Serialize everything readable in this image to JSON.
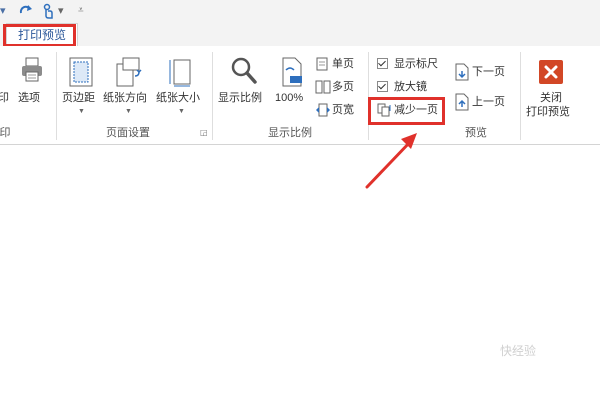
{
  "qat": {
    "undo_caret": "▾",
    "redo_caret": "▾",
    "customize": "⩡"
  },
  "tabs": {
    "print_preview": "打印预览"
  },
  "ribbon": {
    "print_group": {
      "options_label": "选项",
      "partial_left": "印",
      "group_label_partial": "印"
    },
    "page_setup": {
      "margins": "页边距",
      "orientation": "纸张方向",
      "size": "纸张大小",
      "group_label": "页面设置"
    },
    "zoom": {
      "zoom": "显示比例",
      "hundred": "100%",
      "one_page": "单页",
      "multi_page": "多页",
      "page_width": "页宽",
      "group_label": "显示比例"
    },
    "preview": {
      "show_ruler": "显示标尺",
      "magnifier": "放大镜",
      "shrink_one_page": "减少一页",
      "next_page": "下一页",
      "prev_page": "上一页",
      "group_label": "预览"
    },
    "close": {
      "line1": "关闭",
      "line2": "打印预览"
    }
  },
  "watermark": {
    "text": "快经验"
  },
  "colors": {
    "accent": "#2b579a",
    "highlight": "#e0312b",
    "close_icon": "#d24726"
  },
  "icons": [
    "undo-icon",
    "redo-icon",
    "touch-mode-icon",
    "printer-icon",
    "margins-icon",
    "orientation-icon",
    "size-icon",
    "zoom-icon",
    "hundred-percent-icon",
    "one-page-icon",
    "multi-page-icon",
    "page-width-icon",
    "shrink-one-page-icon",
    "next-page-icon",
    "prev-page-icon",
    "close-icon",
    "arrow-annotation"
  ]
}
